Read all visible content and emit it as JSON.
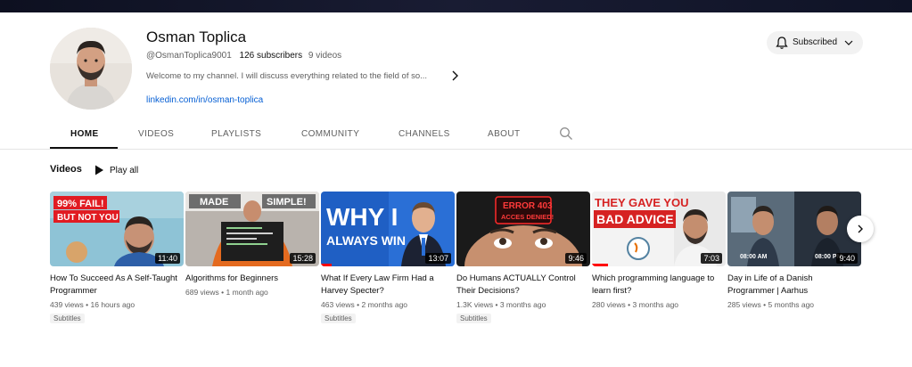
{
  "channel": {
    "name": "Osman Toplica",
    "handle": "@OsmanToplica9001",
    "subscribers": "126 subscribers",
    "videos_count": "9 videos",
    "description": "Welcome to my channel. I will discuss everything related to the field of so...",
    "link": "linkedin.com/in/osman-toplica"
  },
  "subscribe_button": {
    "label": "Subscribed"
  },
  "tabs": [
    {
      "label": "HOME",
      "active": true
    },
    {
      "label": "VIDEOS"
    },
    {
      "label": "PLAYLISTS"
    },
    {
      "label": "COMMUNITY"
    },
    {
      "label": "CHANNELS"
    },
    {
      "label": "ABOUT"
    }
  ],
  "section": {
    "title": "Videos",
    "play_all": "Play all"
  },
  "videos": [
    {
      "title": "How To Succeed As A Self-Taught Programmer",
      "duration": "11:40",
      "views": "439 views",
      "age": "16 hours ago",
      "badge": "Subtitles",
      "thumb_text": [
        "99% FAIL!",
        "BUT NOT YOU"
      ]
    },
    {
      "title": "Algorithms for Beginners",
      "duration": "15:28",
      "views": "689 views",
      "age": "1 month ago",
      "badge": "",
      "thumb_text": [
        "MADE",
        "SIMPLE!"
      ]
    },
    {
      "title": "What If Every Law Firm Had a Harvey Specter?",
      "duration": "13:07",
      "views": "463 views",
      "age": "2 months ago",
      "badge": "Subtitles",
      "thumb_text": [
        "WHY I",
        "ALWAYS WIN"
      ]
    },
    {
      "title": "Do Humans ACTUALLY Control Their Decisions?",
      "duration": "9:46",
      "views": "1.3K views",
      "age": "3 months ago",
      "badge": "Subtitles",
      "thumb_text": [
        "ERROR 403",
        "ACCES DENIED!"
      ]
    },
    {
      "title": "Which programming language to learn first?",
      "duration": "7:03",
      "views": "280 views",
      "age": "3 months ago",
      "badge": "",
      "thumb_text": [
        "THEY GAVE YOU",
        "BAD ADVICE"
      ]
    },
    {
      "title": "Day in Life of a Danish Programmer | Aarhus",
      "duration": "9:40",
      "views": "285 views",
      "age": "5 months ago",
      "badge": "",
      "thumb_text": [
        "08:00 AM",
        "08:00 PM"
      ]
    }
  ],
  "colors": {
    "link": "#065fd4",
    "accent_red": "#ff0000",
    "muted": "#606060"
  },
  "icons": {
    "bell": "bell-icon",
    "search": "search-icon",
    "play": "play-icon",
    "next": "chevron-right-icon"
  }
}
